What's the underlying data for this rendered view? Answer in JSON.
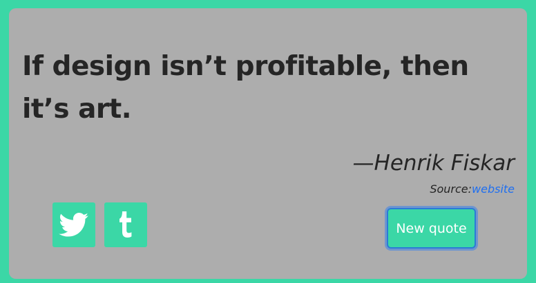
{
  "quote": {
    "text": "If design isn’t profitable, then it’s art.",
    "author": "—Henrik Fiskar",
    "source_label": "Source:",
    "source_link": "website"
  },
  "share": {
    "twitter_icon": "twitter-bird-icon",
    "tumblr_icon": "tumblr-t-icon"
  },
  "actions": {
    "new_quote_label": "New quote"
  },
  "colors": {
    "background": "#3bd7a6",
    "card": "#adadad",
    "text": "#252525",
    "link": "#1f6ff0",
    "button": "#3bd7a6"
  }
}
